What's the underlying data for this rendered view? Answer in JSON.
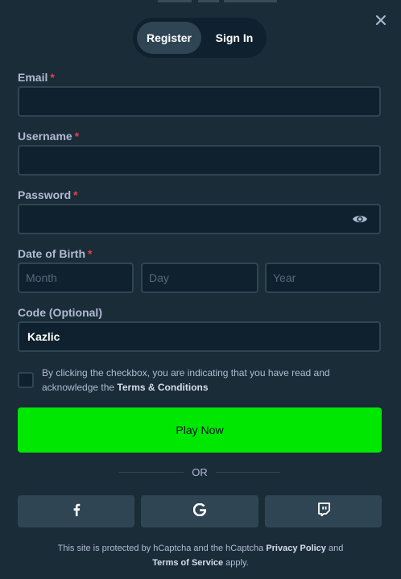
{
  "tabs": [
    {
      "label": "Register",
      "active": true
    },
    {
      "label": "Sign In",
      "active": false
    }
  ],
  "fields": {
    "email": {
      "label": "Email",
      "required_mark": "*",
      "value": ""
    },
    "username": {
      "label": "Username",
      "required_mark": "*",
      "value": ""
    },
    "password": {
      "label": "Password",
      "required_mark": "*",
      "value": ""
    },
    "dob": {
      "label": "Date of Birth",
      "required_mark": "*",
      "month_placeholder": "Month",
      "day_placeholder": "Day",
      "year_placeholder": "Year"
    },
    "code": {
      "label": "Code (Optional)",
      "value": "Kazlic"
    }
  },
  "consent": {
    "text": "By clicking the checkbox, you are indicating that you have read and acknowledge the",
    "link": "Terms & Conditions",
    "checked": false
  },
  "play_button": "Play Now",
  "divider": "OR",
  "social": [
    "facebook-icon",
    "google-icon",
    "twitch-icon"
  ],
  "footer": {
    "pre": "This site is protected by hCaptcha and the hCaptcha",
    "privacy": "Privacy Policy",
    "and": "and",
    "terms": "Terms of Service",
    "post": "apply."
  },
  "colors": {
    "background": "#1a2c38",
    "input_bg": "#0f212e",
    "border": "#2f4553",
    "accent_green": "#00e701",
    "required_red": "#e3424b"
  }
}
